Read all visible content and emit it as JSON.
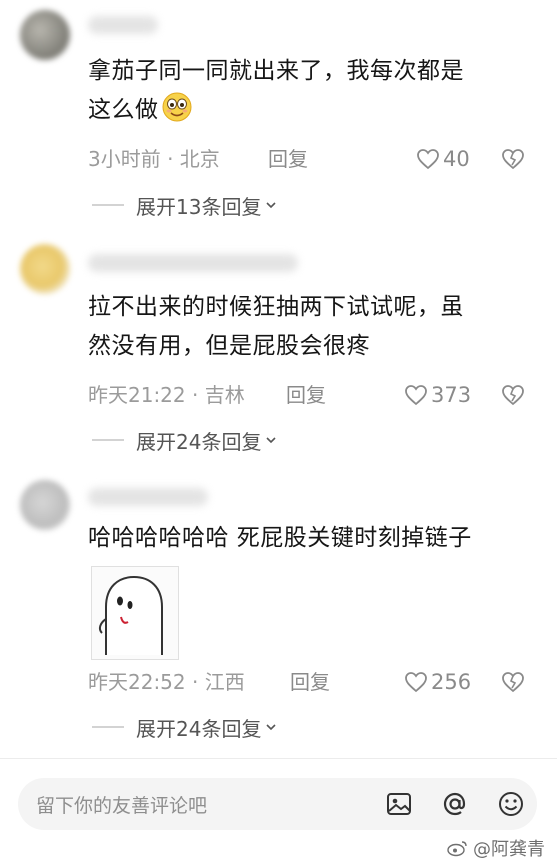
{
  "comments": [
    {
      "text_line1": "拿茄子同一同就出来了，我每次都是",
      "text_line2": "这么做",
      "time_location": "3小时前 · 北京",
      "reply_label": "回复",
      "likes": "40",
      "expand_label": "展开13条回复"
    },
    {
      "text_line1": "拉不出来的时候狂抽两下试试呢，虽",
      "text_line2": "然没有用，但是屁股会很疼",
      "time_location": "昨天21:22 · 吉林",
      "reply_label": "回复",
      "likes": "373",
      "expand_label": "展开24条回复"
    },
    {
      "text_line1": "哈哈哈哈哈哈 死屁股关键时刻掉链子",
      "time_location": "昨天22:52 · 江西",
      "reply_label": "回复",
      "likes": "256",
      "expand_label": "展开24条回复"
    }
  ],
  "composer": {
    "placeholder": "留下你的友善评论吧"
  },
  "watermark": "@阿龚青",
  "icons": {
    "like": "heart-outline-icon",
    "dislike": "broken-heart-icon",
    "expand": "chevron-down-icon",
    "image": "image-icon",
    "mention": "at-sign-icon",
    "emoji": "smiley-icon"
  },
  "colors": {
    "meta_text": "#9b9b9b",
    "body_text": "#161616",
    "input_bg": "#f4f4f4"
  }
}
